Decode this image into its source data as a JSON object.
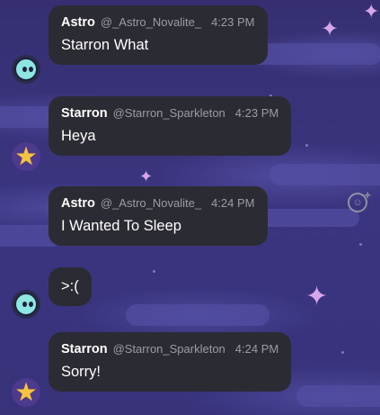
{
  "messages": [
    {
      "author": "Astro",
      "handle": "@_Astro_Novalite_",
      "time": "4:23 PM",
      "text": "Starron What"
    },
    {
      "author": "Starron",
      "handle": "@Starron_Sparkleton",
      "time": "4:23 PM",
      "text": "Heya"
    },
    {
      "author": "Astro",
      "handle": "@_Astro_Novalite_",
      "time": "4:24 PM",
      "text": "I Wanted To Sleep"
    },
    {
      "author": "Astro",
      "text": ">:("
    },
    {
      "author": "Starron",
      "handle": "@Starron_Sparkleton",
      "time": "4:24 PM",
      "text": "Sorry!"
    }
  ],
  "colors": {
    "bubble": "#2b2b33",
    "background": "#3a3a82",
    "meta": "#9c9ca6"
  },
  "icons": {
    "reaction": "add-reaction-icon"
  }
}
